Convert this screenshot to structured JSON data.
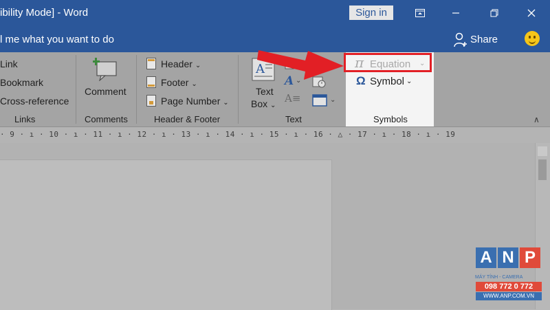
{
  "titlebar": {
    "title": "ibility Mode]  -  Word",
    "signin": "Sign in"
  },
  "tellme": {
    "text": "l me what you want to do",
    "share": "Share"
  },
  "ribbon": {
    "links": {
      "items": [
        "Link",
        "Bookmark",
        "Cross-reference"
      ],
      "group": "Links"
    },
    "comments": {
      "button": "Comment",
      "group": "Comments"
    },
    "header_footer": {
      "header": "Header",
      "footer": "Footer",
      "page_number": "Page Number",
      "group": "Header & Footer"
    },
    "text": {
      "textbox_1": "Text",
      "textbox_2": "Box",
      "group": "Text"
    },
    "symbols": {
      "equation": "Equation",
      "symbol": "Symbol",
      "group": "Symbols"
    }
  },
  "ruler": "· 9 · ı · 10 · ı · 11 · ı · 12 · ı · 13 · ı · 14 · ı · 15 · ı · 16 · △ · 17 · ı · 18 · ı · 19",
  "watermark": {
    "letters": [
      "A",
      "N",
      "P"
    ],
    "tagline": "MÁY TÍNH - CAMERA",
    "phone": "098 772 0 772",
    "site": "WWW.ANP.COM.VN"
  },
  "colors": {
    "word_blue": "#2b579a",
    "highlight_red": "#e21f25"
  }
}
